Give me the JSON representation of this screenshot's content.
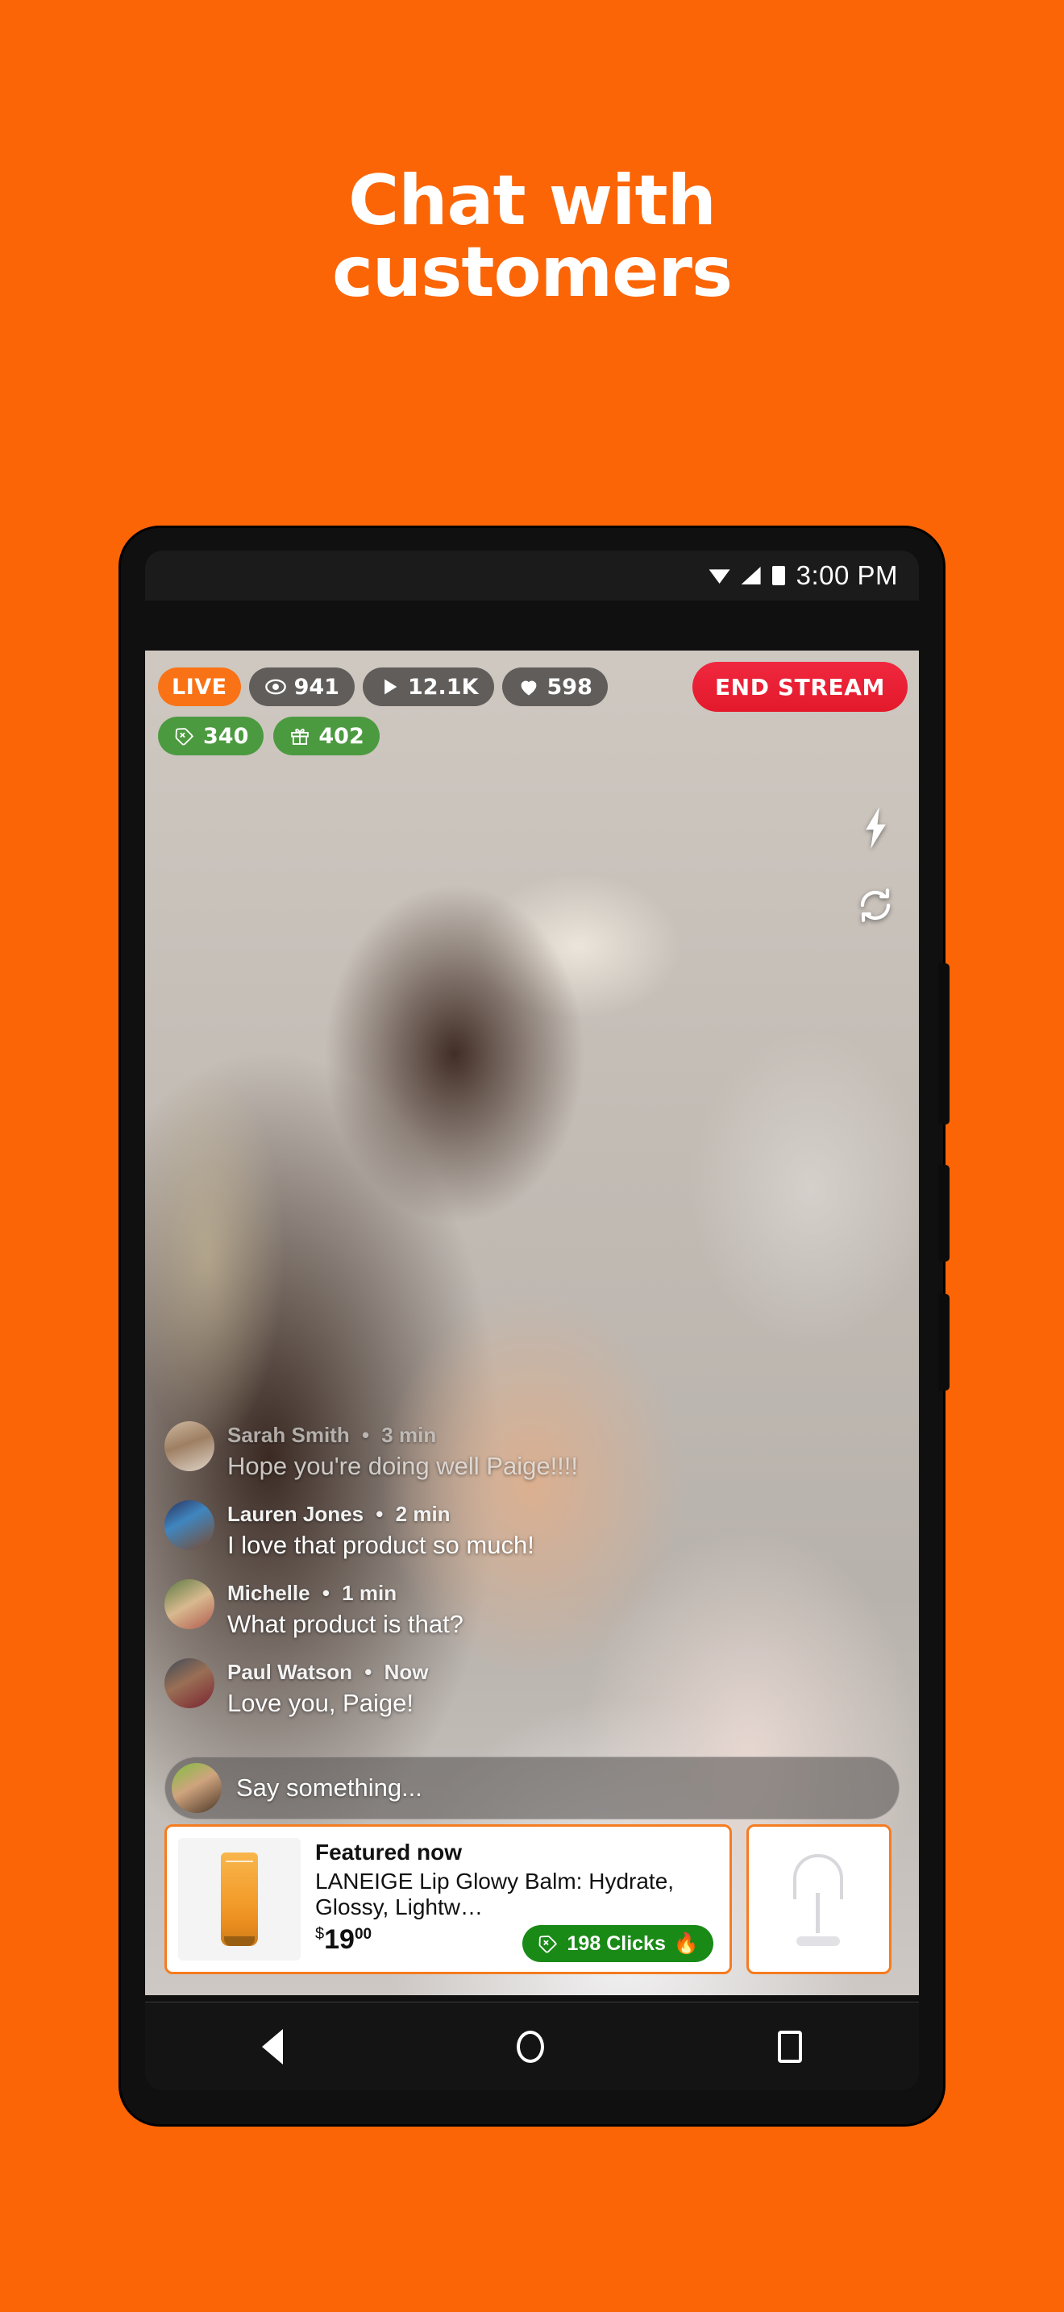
{
  "page": {
    "background_color": "#FB6506",
    "headline": {
      "line1": "Chat with",
      "line2": "customers"
    }
  },
  "phone": {
    "status_bar": {
      "time": "3:00 PM",
      "icons": [
        "wifi-icon",
        "signal-icon",
        "battery-icon"
      ]
    },
    "nav_bar": {
      "back": "back-triangle-icon",
      "home": "home-circle-icon",
      "recents": "recents-square-icon"
    }
  },
  "stream": {
    "live_label": "LIVE",
    "stats": [
      {
        "icon": "eye-icon",
        "value": "941"
      },
      {
        "icon": "play-icon",
        "value": "12.1K"
      },
      {
        "icon": "heart-icon",
        "value": "598"
      }
    ],
    "stats_row2": [
      {
        "icon": "tag-icon",
        "value": "340"
      },
      {
        "icon": "gift-icon",
        "value": "402"
      }
    ],
    "end_stream_label": "END STREAM",
    "camera_controls": [
      {
        "icon": "flash-icon"
      },
      {
        "icon": "camera-flip-icon"
      }
    ],
    "colors": {
      "live_badge": "#F97316",
      "stat_badge": "rgba(72,70,68,.82)",
      "green_badge": "#4C9A40",
      "end_stream": "#E3192B",
      "clicks_badge": "#1A8A17",
      "card_border": "#F57C1F"
    }
  },
  "chat": {
    "messages": [
      {
        "author": "Sarah Smith",
        "time": "3 min",
        "text": "Hope you're doing well Paige!!!!"
      },
      {
        "author": "Lauren Jones",
        "time": "2 min",
        "text": "I love that product so much!"
      },
      {
        "author": "Michelle",
        "time": "1 min",
        "text": "What product is that?"
      },
      {
        "author": "Paul Watson",
        "time": "Now",
        "text": "Love you, Paige!"
      }
    ],
    "separator": "•",
    "input": {
      "placeholder": "Say something..."
    }
  },
  "products": [
    {
      "eyebrow": "Featured now",
      "title": "LANEIGE Lip Glowy Balm: Hydrate, Glossy, Lightw…",
      "currency": "$",
      "price_dollars": "19",
      "price_cents": "00",
      "clicks_label": "198 Clicks",
      "clicks_emoji": "🔥"
    }
  ]
}
